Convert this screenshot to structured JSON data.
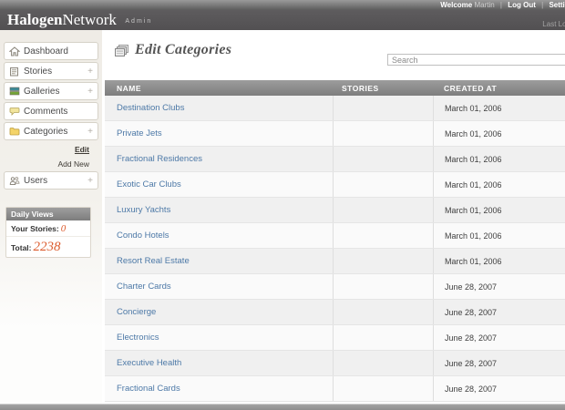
{
  "header": {
    "utility": {
      "welcome_prefix": "Welcome",
      "user": "Martin",
      "logout": "Log Out",
      "settings": "Settings"
    },
    "brand": {
      "name_bold": "Halogen",
      "name_regular": "Network",
      "suffix": "Admin"
    },
    "last_login": "Last Log"
  },
  "sidebar": {
    "items": [
      {
        "label": "Dashboard",
        "icon": "home-icon",
        "expandable": false
      },
      {
        "label": "Stories",
        "icon": "story-icon",
        "expandable": true
      },
      {
        "label": "Galleries",
        "icon": "gallery-icon",
        "expandable": true
      },
      {
        "label": "Comments",
        "icon": "comment-icon",
        "expandable": false
      },
      {
        "label": "Categories",
        "icon": "folder-icon",
        "expandable": true,
        "submenu": [
          {
            "label": "Edit",
            "active": true
          },
          {
            "label": "Add New",
            "active": false
          }
        ]
      },
      {
        "label": "Users",
        "icon": "users-icon",
        "expandable": true
      }
    ],
    "daily_views": {
      "title": "Daily Views",
      "rows": [
        {
          "label": "Your Stories:",
          "value": "0"
        },
        {
          "label": "Total:",
          "value": "2238"
        }
      ]
    }
  },
  "main": {
    "title": "Edit Categories",
    "search": {
      "placeholder": "Search"
    },
    "table": {
      "columns": [
        "NAME",
        "STORIES",
        "CREATED AT"
      ],
      "rows": [
        {
          "name": "Destination Clubs",
          "stories": "",
          "created_at": "March 01, 2006"
        },
        {
          "name": "Private Jets",
          "stories": "",
          "created_at": "March 01, 2006"
        },
        {
          "name": "Fractional Residences",
          "stories": "",
          "created_at": "March 01, 2006"
        },
        {
          "name": "Exotic Car Clubs",
          "stories": "",
          "created_at": "March 01, 2006"
        },
        {
          "name": "Luxury Yachts",
          "stories": "",
          "created_at": "March 01, 2006"
        },
        {
          "name": "Condo Hotels",
          "stories": "",
          "created_at": "March 01, 2006"
        },
        {
          "name": "Resort Real Estate",
          "stories": "",
          "created_at": "March 01, 2006"
        },
        {
          "name": "Charter Cards",
          "stories": "",
          "created_at": "June 28, 2007"
        },
        {
          "name": "Concierge",
          "stories": "",
          "created_at": "June 28, 2007"
        },
        {
          "name": "Electronics",
          "stories": "",
          "created_at": "June 28, 2007"
        },
        {
          "name": "Executive Health",
          "stories": "",
          "created_at": "June 28, 2007"
        },
        {
          "name": "Fractional Cards",
          "stories": "",
          "created_at": "June 28, 2007"
        }
      ]
    }
  },
  "colors": {
    "accent_value": "#dc5c2e",
    "link_blue": "#4d79a7",
    "header_dark": "#565456",
    "table_header_gray": "#8d8d8d",
    "sidebar_beige": "#efece6"
  }
}
